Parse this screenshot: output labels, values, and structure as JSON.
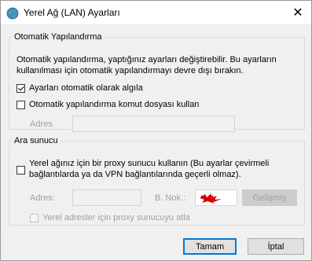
{
  "window": {
    "title": "Yerel Ağ (LAN) Ayarları",
    "icon": "network-globe-icon",
    "close_glyph": "✕"
  },
  "auto_config": {
    "legend": "Otomatik Yapılandırma",
    "description_line1": "Otomatik yapılandırma, yaptığınız ayarları değiştirebilir. Bu ayarların",
    "description_line2": "kullanılması için otomatik yapılandırmayı devre dışı bırakın.",
    "detect_label": "Ayarları otomatik olarak algıla",
    "detect_checked": true,
    "script_label": "Otomatik yapılandırma komut dosyası kullan",
    "script_checked": false,
    "address_label": "Adres",
    "address_value": ""
  },
  "proxy": {
    "legend": "Ara sunucu",
    "use_label_line1": "Yerel ağınız için bir proxy sunucu kullanın (Bu ayarlar çevirmeli",
    "use_label_line2": "bağlantılarda ya da VPN bağlantılarında geçerli olmaz).",
    "use_checked": false,
    "address_label": "Adres:",
    "address_value": "",
    "port_label": "B. Nok.:",
    "port_value": "",
    "advanced_label": "Gelişmiş",
    "bypass_label": "Yerel adresler için proxy sunucuyu atla",
    "bypass_checked": false
  },
  "buttons": {
    "ok": "Tamam",
    "cancel": "İptal"
  },
  "colors": {
    "accent": "#0078d7",
    "redaction": "#e00000"
  }
}
